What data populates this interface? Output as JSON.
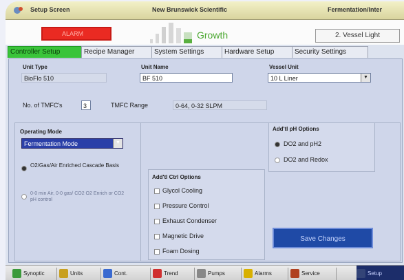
{
  "titlebar": {
    "left_text": "Setup Screen",
    "center_text": "New Brunswick Scientific",
    "right_text": "Fermentation/Inter"
  },
  "status": {
    "alarm_text": "ALARM",
    "phase": "Growth",
    "vessel_light": "2. Vessel Light"
  },
  "tabs": [
    {
      "label": "Controller Setup",
      "active": true
    },
    {
      "label": "Recipe Manager",
      "active": false
    },
    {
      "label": "System Settings",
      "active": false
    },
    {
      "label": "Hardware Setup",
      "active": false
    },
    {
      "label": "Security Settings",
      "active": false
    }
  ],
  "form": {
    "unit_type_label": "Unit Type",
    "unit_type_value": "BioFlo 510",
    "unit_name_label": "Unit Name",
    "unit_name_value": "BF 510",
    "vessel_unit_label": "Vessel Unit",
    "vessel_unit_value": "10 L Liner",
    "tmfc_count_label": "No. of TMFC's",
    "tmfc_count_value": "3",
    "tmfc_range_label": "TMFC Range",
    "tmfc_range_value": "0-64, 0-32 SLPM",
    "operating_mode_label": "Operating Mode",
    "operating_mode_value": "Fermentation Mode",
    "cascade_option": "O2/Gas/Air Enriched Cascade Basis",
    "alt_option": "0-0 min Air, 0-0 gas/ CO2 O2 Enrich or CO2 pH control"
  },
  "add_ph_options": {
    "title": "Add'tl pH Options",
    "options": [
      {
        "label": "DO2 and pH2",
        "selected": true
      },
      {
        "label": "DO2 and Redox",
        "selected": false
      }
    ]
  },
  "add_options": {
    "title": "Add'tl Ctrl Options",
    "items": [
      "Glycol Cooling",
      "Pressure Control",
      "Exhaust Condenser",
      "Magnetic Drive",
      "Foam Dosing"
    ]
  },
  "save_button": "Save Changes",
  "nav": [
    {
      "label": "Synoptic",
      "icon": "synoptic-icon",
      "color": "#3c9a3c"
    },
    {
      "label": "Units",
      "icon": "units-icon",
      "color": "#c8a020"
    },
    {
      "label": "Cont.",
      "icon": "controls-icon",
      "color": "#3a6ad0"
    },
    {
      "label": "Trend",
      "icon": "trend-icon",
      "color": "#d03030"
    },
    {
      "label": "Pumps",
      "icon": "pumps-icon",
      "color": "#888888"
    },
    {
      "label": "Alarms",
      "icon": "alarm-icon",
      "color": "#d8b000"
    },
    {
      "label": "Service",
      "icon": "service-icon",
      "color": "#b04020"
    },
    {
      "label": "Setup",
      "icon": "setup-icon",
      "color": "#334477"
    }
  ]
}
